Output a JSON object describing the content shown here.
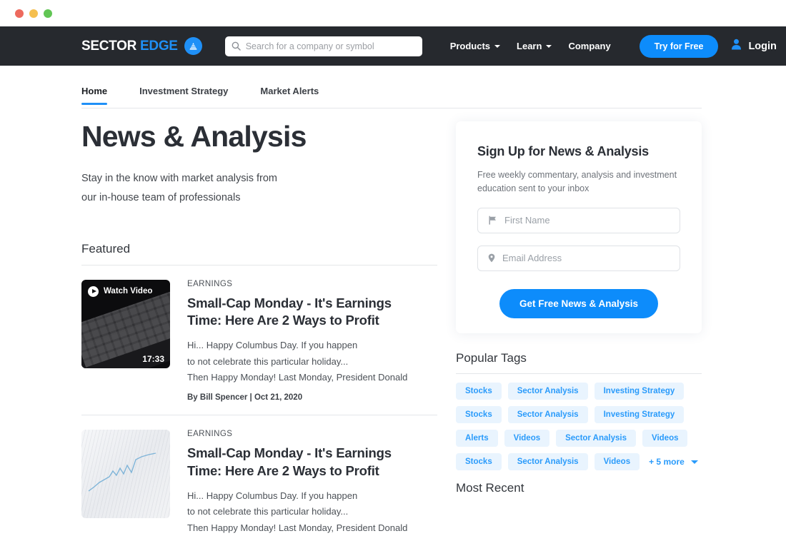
{
  "window": {
    "traffic_lights": [
      "close",
      "minimize",
      "maximize"
    ],
    "colors": {
      "close": "#ed6a5e",
      "minimize": "#f5bf4f",
      "maximize": "#61c554"
    }
  },
  "topbar": {
    "background": "#26292e",
    "logo": {
      "primary": "SECTOR",
      "secondary": "EDGE",
      "mark": "mountain-icon"
    },
    "search": {
      "placeholder": "Search for a company or symbol",
      "value": "",
      "icon": "search-icon"
    },
    "nav": [
      {
        "label": "Products",
        "has_caret": true
      },
      {
        "label": "Learn",
        "has_caret": true
      },
      {
        "label": "Company",
        "has_caret": false
      }
    ],
    "cta": {
      "label": "Try for Free",
      "color": "#0d8cfb"
    },
    "login": {
      "label": "Login",
      "icon": "user-icon"
    }
  },
  "tabs": [
    {
      "label": "Home",
      "active": true
    },
    {
      "label": "Investment Strategy",
      "active": false
    },
    {
      "label": "Market Alerts",
      "active": false
    }
  ],
  "hero": {
    "title": "News & Analysis",
    "subtitle_line1": "Stay in the know with market analysis from",
    "subtitle_line2": "our in-house team of professionals"
  },
  "featured": {
    "heading": "Featured",
    "articles": [
      {
        "category": "EARNINGS",
        "title_line1": "Small-Cap Monday - It's Earnings",
        "title_line2": "Time: Here Are 2 Ways to Profit",
        "excerpt_line1": "Hi... Happy Columbus Day. If you happen",
        "excerpt_line2": "to not celebrate this particular holiday...",
        "excerpt_line3": "Then Happy Monday! Last Monday, President Donald",
        "byline": "By Bill Spencer | Oct 21, 2020",
        "media": {
          "type": "video",
          "badge": "Watch Video",
          "duration": "17:33"
        }
      },
      {
        "category": "EARNINGS",
        "title_line1": "Small-Cap Monday - It's Earnings",
        "title_line2": "Time: Here Are 2 Ways to Profit",
        "excerpt_line1": "Hi... Happy Columbus Day. If you happen",
        "excerpt_line2": "to not celebrate this particular holiday...",
        "excerpt_line3": "Then Happy Monday! Last Monday, President Donald",
        "byline": "",
        "media": {
          "type": "image",
          "badge": "",
          "duration": ""
        }
      }
    ]
  },
  "signup": {
    "title": "Sign Up for News & Analysis",
    "subtitle": "Free weekly commentary, analysis and investment education sent to your inbox",
    "first_name": {
      "placeholder": "First Name",
      "value": "",
      "icon": "flag-icon"
    },
    "email": {
      "placeholder": "Email Address",
      "value": "",
      "icon": "location-pin-icon"
    },
    "submit_label": "Get Free News & Analysis"
  },
  "tags": {
    "heading": "Popular Tags",
    "rows": [
      [
        "Stocks",
        "Sector Analysis",
        "Investing Strategy"
      ],
      [
        "Stocks",
        "Sector Analysis",
        "Investing Strategy"
      ],
      [
        "Alerts",
        "Videos",
        "Sector Analysis",
        "Videos"
      ],
      [
        "Stocks",
        "Sector Analysis",
        "Videos"
      ]
    ],
    "more_label": "+ 5 more",
    "accent": "#2a9bfb",
    "pill_bg": "#e9f4fe"
  },
  "recent": {
    "heading": "Most Recent"
  }
}
